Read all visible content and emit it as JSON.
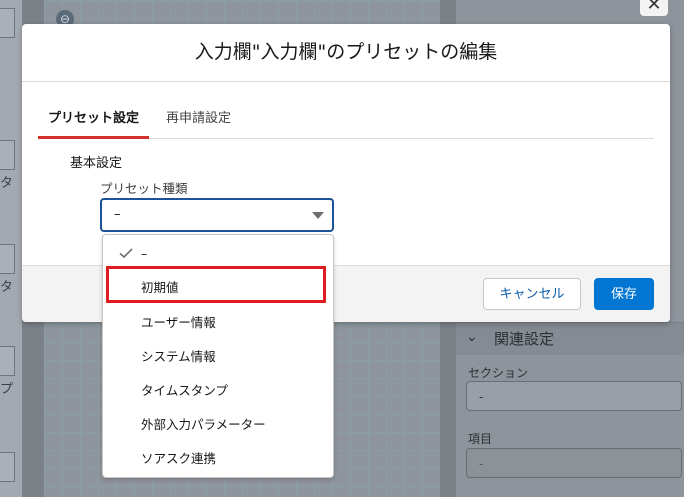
{
  "modal": {
    "title": "入力欄\"入力欄\"のプリセットの編集",
    "tabs": [
      {
        "label": "プリセット設定",
        "active": true
      },
      {
        "label": "再申請設定",
        "active": false
      }
    ],
    "fieldset_legend": "基本設定",
    "preset_type": {
      "label": "プリセット種類",
      "value": "–"
    },
    "footer": {
      "cancel_label": "キャンセル",
      "save_label": "保存"
    }
  },
  "dropdown": {
    "options": [
      {
        "label": "–",
        "selected": true
      },
      {
        "label": "初期値",
        "selected": false
      },
      {
        "label": "ユーザー情報",
        "selected": false
      },
      {
        "label": "システム情報",
        "selected": false
      },
      {
        "label": "タイムスタンプ",
        "selected": false
      },
      {
        "label": "外部入力パラメーター",
        "selected": false
      },
      {
        "label": "ソアスク連携",
        "selected": false
      }
    ]
  },
  "background": {
    "left_glyphs": [
      "タ",
      "タ",
      "プ"
    ],
    "section_title": "関連設定",
    "section_label": "セクション",
    "section_value": "-",
    "item_label": "項目",
    "item_value": "-"
  },
  "colors": {
    "accent_tab": "#d4302b",
    "brand_button": "#0176d3",
    "focus_border": "#1b5297",
    "annotation": "#e01b22"
  }
}
